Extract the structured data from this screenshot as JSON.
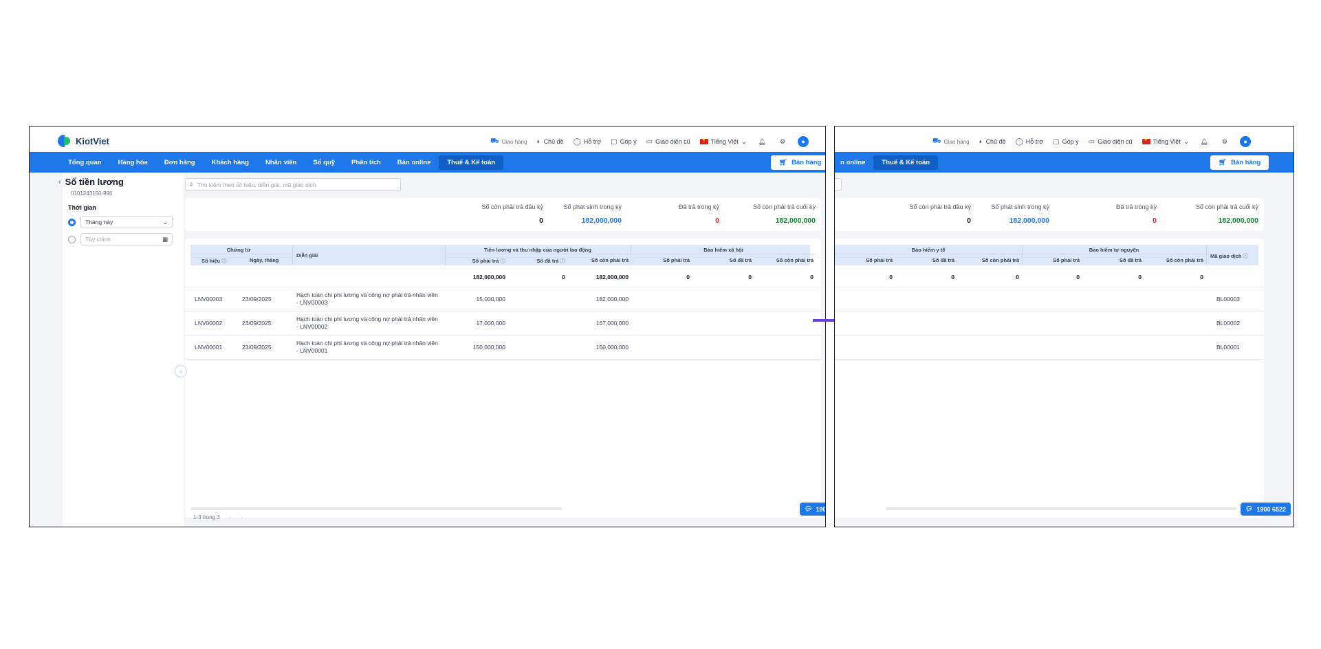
{
  "app": {
    "name": "KiotViet"
  },
  "topbar": {
    "delivery": "Giao hàng",
    "theme": "Chủ đề",
    "support": "Hỗ trợ",
    "feedback": "Góp ý",
    "old_ui": "Giao diện cũ",
    "language": "Tiếng Việt"
  },
  "nav": {
    "items": [
      "Tổng quan",
      "Hàng hóa",
      "Đơn hàng",
      "Khách hàng",
      "Nhân viên",
      "Sổ quỹ",
      "Phân tích",
      "Bán online",
      "Thuế & Kế toán"
    ],
    "right_items": [
      "n online",
      "Thuế & Kế toán"
    ],
    "active": "Thuế & Kế toán",
    "sell_button": "Bán hàng"
  },
  "page": {
    "title": "Sổ tiền lương",
    "tax_code": "0101243150-996"
  },
  "filters": {
    "time_label": "Thời gian",
    "period_value": "Tháng này",
    "custom_placeholder": "Tùy chỉnh"
  },
  "search": {
    "placeholder": "Tìm kiếm theo số hiệu, diễn giải, mã giao dịch"
  },
  "summary": {
    "opening_label": "Số còn phải trả đầu kỳ",
    "opening_value": "0",
    "incurred_label": "Số phát sinh trong kỳ",
    "incurred_value": "182,000,000",
    "paid_label": "Đã trả trong kỳ",
    "paid_value": "0",
    "closing_label": "Số còn phải trả cuối kỳ",
    "closing_value": "182,000,000"
  },
  "colors": {
    "primary": "#1d77e8",
    "positive": "#0a8a2f",
    "negative": "#e02424",
    "blue_value": "#1d77e8"
  },
  "table": {
    "group_doc": "Chứng từ",
    "col_number": "Số hiệu",
    "col_date": "Ngày, tháng",
    "col_desc": "Diễn giải",
    "group_salary": "Tiền lương và thu nhập của người lao động",
    "group_social": "Bảo hiểm xã hội",
    "group_health": "Bảo hiểm y tế",
    "group_voluntary": "Bảo hiểm tự nguyện",
    "col_payable": "Số phải trả",
    "col_paid": "Số đã trả",
    "col_remaining": "Số còn phải trả",
    "col_txn": "Mã giao dịch",
    "totals": {
      "salary_payable": "182,000,000",
      "salary_paid": "0",
      "salary_remaining": "182,000,000",
      "social_payable": "0",
      "social_paid": "0",
      "social_remaining": "0",
      "health_payable": "0",
      "health_paid": "0",
      "health_remaining": "0",
      "vol_payable": "0",
      "vol_paid": "0",
      "vol_remaining": "0"
    },
    "rows": [
      {
        "number": "LNV00003",
        "date": "23/09/2025",
        "desc": "Hạch toán chi phí lương và công nợ phải trả nhân viên - LNV00003",
        "payable": "15,000,000",
        "remaining": "182,000,000",
        "txn": "BL00003"
      },
      {
        "number": "LNV00002",
        "date": "23/09/2025",
        "desc": "Hạch toán chi phí lương và công nợ phải trả nhân viên - LNV00002",
        "payable": "17,000,000",
        "remaining": "167,000,000",
        "txn": "BL00002"
      },
      {
        "number": "LNV00001",
        "date": "23/09/2025",
        "desc": "Hạch toán chi phí lương và công nợ phải trả nhân viên - LNV00001",
        "payable": "150,000,000",
        "remaining": "150,000,000",
        "txn": "BL00001"
      }
    ],
    "pager": "1-3 trong 3"
  },
  "hotline": {
    "left": "1900 65",
    "right": "1900 6522"
  }
}
